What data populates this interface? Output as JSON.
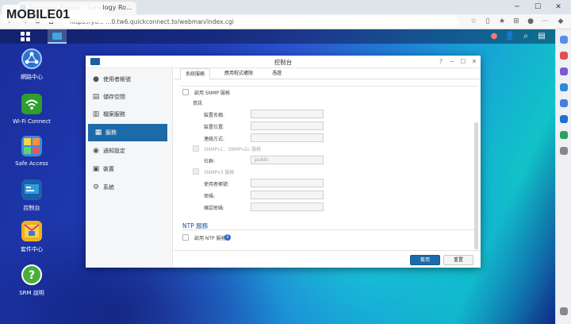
{
  "browser": {
    "tab_title": "Synology Router - Synology Ro...",
    "url": "https://yo...   ...0.tw6.quickconnect.to/webman/index.cgi",
    "back_icon": "arrow-left-icon",
    "forward_icon": "arrow-right-icon",
    "reload_icon": "reload-icon",
    "home_icon": "home-icon"
  },
  "watermark": "MOBILE01",
  "desktop": {
    "icons": [
      {
        "label": "網路中心",
        "icon": "network-center-icon",
        "color": "#2e6fd1"
      },
      {
        "label": "Wi-Fi Connect",
        "icon": "wifi-icon",
        "color": "#2f9e2f"
      },
      {
        "label": "Safe Access",
        "icon": "safe-access-icon",
        "color": "#3a8de0"
      },
      {
        "label": "控制台",
        "icon": "control-panel-icon",
        "color": "#1d5fa8"
      },
      {
        "label": "套件中心",
        "icon": "package-center-icon",
        "color": "#f0b020"
      },
      {
        "label": "SRM 說明",
        "icon": "help-icon",
        "color": "#4cae3a"
      }
    ]
  },
  "control_panel": {
    "title": "控制台",
    "sidebar": [
      {
        "label": "使用者帳號",
        "icon": "user-icon"
      },
      {
        "label": "儲存空間",
        "icon": "storage-icon"
      },
      {
        "label": "檔案服務",
        "icon": "file-service-icon"
      },
      {
        "label": "服務",
        "icon": "services-icon"
      },
      {
        "label": "通知設定",
        "icon": "notification-icon"
      },
      {
        "label": "裝置",
        "icon": "device-icon"
      },
      {
        "label": "系統",
        "icon": "system-gear-icon"
      }
    ],
    "tabs": [
      {
        "label": "系統服務"
      },
      {
        "label": "應用程式權限"
      },
      {
        "label": "憑證"
      }
    ],
    "snmp": {
      "enable_label": "啟用 SNMP 服務",
      "info_label": "資訊",
      "device_name_label": "裝置名稱:",
      "device_location_label": "裝置位置:",
      "contact_label": "連絡方式:",
      "v1v2_label": "SNMPv1、SNMPv2c 服務",
      "community_label": "社群:",
      "community_value": "public",
      "v3_label": "SNMPv3 服務",
      "username_label": "使用者帳號:",
      "password_label": "密碼:",
      "confirm_label": "確認密碼:"
    },
    "ntp": {
      "title": "NTP 服務",
      "enable_label": "啟用 NTP 服務",
      "info_icon": "info-icon"
    },
    "buttons": {
      "apply": "套用",
      "reset": "重置"
    }
  }
}
